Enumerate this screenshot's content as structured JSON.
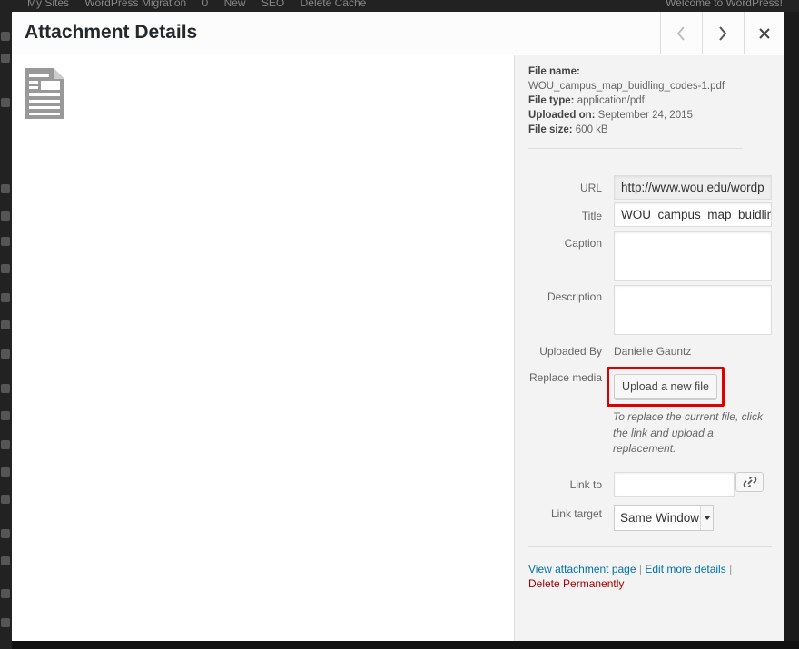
{
  "admin_bar": {
    "items": [
      "My Sites",
      "WordPress Migration",
      "0",
      "New",
      "SEO",
      "Delete Cache"
    ],
    "greeting": "Welcome to WordPress!"
  },
  "modal": {
    "title": "Attachment Details",
    "icons": {
      "prev": "chevron-left-icon",
      "next": "chevron-right-icon",
      "close": "close-icon",
      "file": "document-icon"
    }
  },
  "file_info": {
    "name_label": "File name:",
    "name_value": "WOU_campus_map_buidling_codes-1.pdf",
    "type_label": "File type:",
    "type_value": "application/pdf",
    "uploaded_label": "Uploaded on:",
    "uploaded_value": "September 24, 2015",
    "size_label": "File size:",
    "size_value": "600 kB"
  },
  "fields": {
    "url_label": "URL",
    "url_value": "http://www.wou.edu/wordp",
    "title_label": "Title",
    "title_value": "WOU_campus_map_buidlin",
    "caption_label": "Caption",
    "caption_value": "",
    "description_label": "Description",
    "description_value": "",
    "uploaded_by_label": "Uploaded By",
    "uploaded_by_value": "Danielle Gauntz",
    "replace_label": "Replace media",
    "upload_button": "Upload a new file",
    "replace_hint": "To replace the current file, click the link and upload a replacement.",
    "link_to_label": "Link to",
    "link_to_value": "",
    "link_target_label": "Link target",
    "link_target_value": "Same Window"
  },
  "actions": {
    "view": "View attachment page",
    "sep1": "|",
    "edit": "Edit more details",
    "sep2": "|",
    "delete": "Delete Permanently"
  },
  "colors": {
    "highlight_box": "#dd0000",
    "link": "#0073aa",
    "delete": "#aa0000"
  }
}
